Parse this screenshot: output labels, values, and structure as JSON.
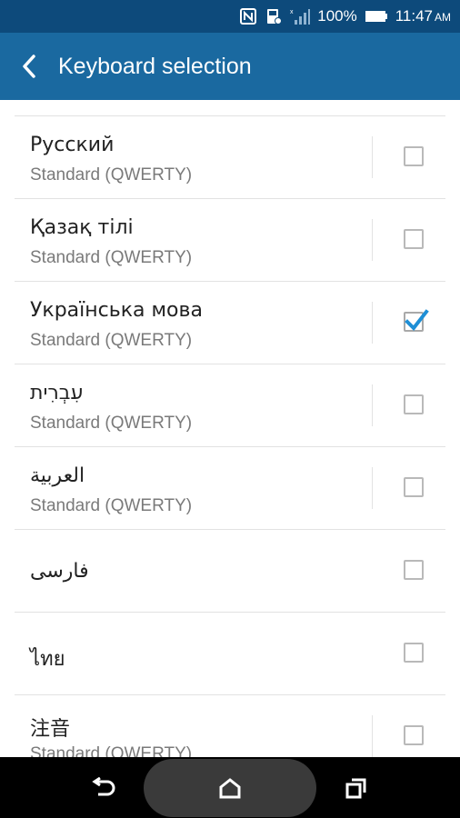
{
  "status_bar": {
    "battery_percent": "100%",
    "time": "11:47",
    "ampm": "AM",
    "icons": [
      "nfc-icon",
      "data-saver-icon",
      "signal-icon",
      "battery-icon"
    ]
  },
  "header": {
    "title": "Keyboard selection",
    "back_icon": "back-arrow-icon",
    "background": "#1a69a0",
    "status_background": "#0d4a7b"
  },
  "keyboards": [
    {
      "name": "Русский",
      "layout": "Standard (QWERTY)",
      "checked": false
    },
    {
      "name": "Қазақ тілі",
      "layout": "Standard (QWERTY)",
      "checked": false
    },
    {
      "name": "Українська мова",
      "layout": "Standard (QWERTY)",
      "checked": true
    },
    {
      "name": "עִבְרִית",
      "layout": "Standard (QWERTY)",
      "checked": false
    },
    {
      "name": "العربية",
      "layout": "Standard (QWERTY)",
      "checked": false
    },
    {
      "name": "فارسی",
      "layout": "",
      "checked": false
    },
    {
      "name": "ไทย",
      "layout": "",
      "checked": false
    },
    {
      "name": "注音",
      "layout": "Standard (QWERTY)",
      "checked": false
    }
  ],
  "accent_color": "#1e8fd6",
  "nav_bar": {
    "back_icon": "nav-back-icon",
    "home_icon": "nav-home-icon",
    "recents_icon": "nav-recents-icon"
  }
}
